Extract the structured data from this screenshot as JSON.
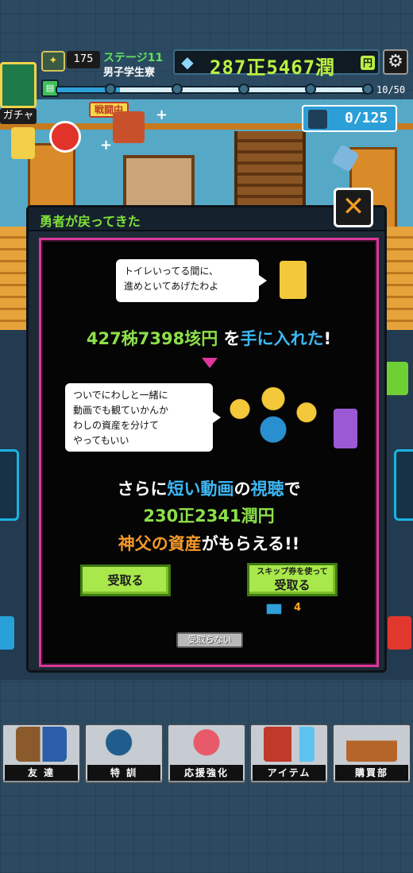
{
  "hud": {
    "level": "175",
    "stage": "ステージ11",
    "dorm": "男子学生寮",
    "money": "287正5467潤",
    "money_unit": "円",
    "wave": "10/50",
    "progress_fraction": 0.2,
    "gacha_label": "ガチャ",
    "battle_status": "戦闘中",
    "enemy_counter": "0/125"
  },
  "dialog": {
    "title": "勇者が戻ってきた",
    "bubble1": [
      "トイレいってる間に、",
      "進めといてあげたわよ"
    ],
    "reward_amount": "427秭7398垓円",
    "reward_suffix_prefix": "を",
    "reward_suffix_blue": "手に入れた",
    "reward_suffix_end": "!",
    "bubble2": [
      "ついでにわしと一緒に",
      "動画でも観ていかんか",
      "わしの資産を分けて",
      "やってもいい"
    ],
    "offer_prefix": "さらに",
    "offer_blue1": "短い動画",
    "offer_mid": "の",
    "offer_blue2": "視聴",
    "offer_end": "で",
    "offer_amount": "230正2341潤円",
    "offer_orange": "神父の資産",
    "offer_tail": "がもらえる!!",
    "receive_button": "受取る",
    "skip_button_line1": "スキップ券を使って",
    "skip_button_line2": "受取る",
    "ticket_count": "4",
    "decline_button": "受取らない"
  },
  "nav": [
    {
      "label": "友 達"
    },
    {
      "label": "特 訓"
    },
    {
      "label": "応援強化"
    },
    {
      "label": "アイテム"
    },
    {
      "label": "購買部"
    }
  ],
  "colors": {
    "accent_green": "#8de04a",
    "accent_blue": "#3db8f5",
    "accent_orange": "#f59a2a",
    "frame_pink": "#d9389a"
  }
}
